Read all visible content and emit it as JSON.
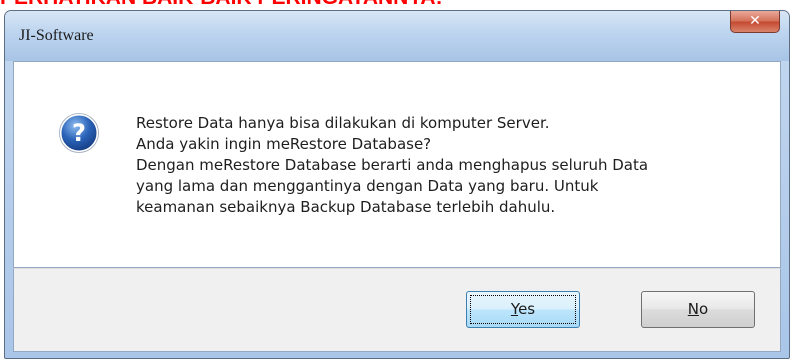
{
  "banner": {
    "text": "PERHATIKAN BAIK-BAIK PERINGATANNYA!"
  },
  "window": {
    "title": "JI-Software",
    "close_symbol": "✕"
  },
  "message": {
    "lines": [
      "Restore Data hanya bisa dilakukan di komputer Server.",
      "Anda yakin ingin meRestore Database?",
      "Dengan meRestore Database berarti anda menghapus seluruh Data",
      "yang lama dan menggantinya dengan Data yang baru. Untuk",
      "keamanan sebaiknya Backup Database terlebih dahulu."
    ]
  },
  "buttons": {
    "yes": {
      "mnemonic": "Y",
      "rest": "es"
    },
    "no": {
      "mnemonic": "N",
      "rest": "o"
    }
  },
  "icons": {
    "dialog": "question-icon",
    "close": "close-icon"
  },
  "colors": {
    "banner": "#ff0000",
    "question_icon": "#2a63b8"
  }
}
